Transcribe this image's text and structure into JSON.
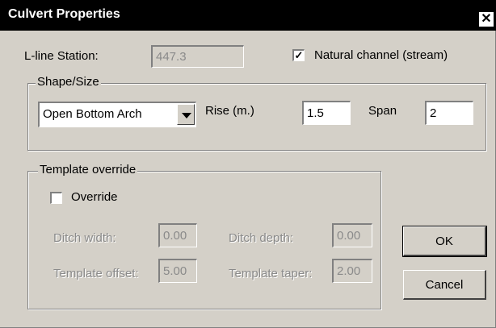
{
  "window": {
    "title": "Culvert Properties",
    "close_glyph": "✕"
  },
  "lline": {
    "label": "L-line Station:",
    "value": "447.3"
  },
  "natural_channel": {
    "label": "Natural channel (stream)",
    "checked": true
  },
  "shape_size": {
    "title": "Shape/Size",
    "shape_value": "Open Bottom Arch",
    "rise_label": "Rise (m.)",
    "rise_value": "1.5",
    "span_label": "Span",
    "span_value": "2"
  },
  "template_override": {
    "title": "Template override",
    "override_label": "Override",
    "override_checked": false,
    "ditch_width_label": "Ditch width:",
    "ditch_width_value": "0.00",
    "ditch_depth_label": "Ditch depth:",
    "ditch_depth_value": "0.00",
    "template_offset_label": "Template offset:",
    "template_offset_value": "5.00",
    "template_taper_label": "Template taper:",
    "template_taper_value": "2.00"
  },
  "buttons": {
    "ok": "OK",
    "cancel": "Cancel"
  },
  "icons": {
    "close": "close-icon",
    "dropdown": "chevron-down-icon",
    "check": "check-icon"
  }
}
